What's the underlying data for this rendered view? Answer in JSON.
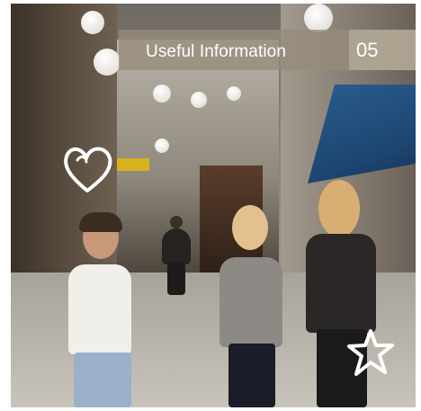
{
  "header": {
    "title": "Useful Information",
    "page_number": "05"
  },
  "doodles": {
    "heart": "heart-doodle-icon",
    "star": "star-doodle-icon"
  },
  "colors": {
    "banner": "#968c7a",
    "awning": "#2a5d8f"
  }
}
